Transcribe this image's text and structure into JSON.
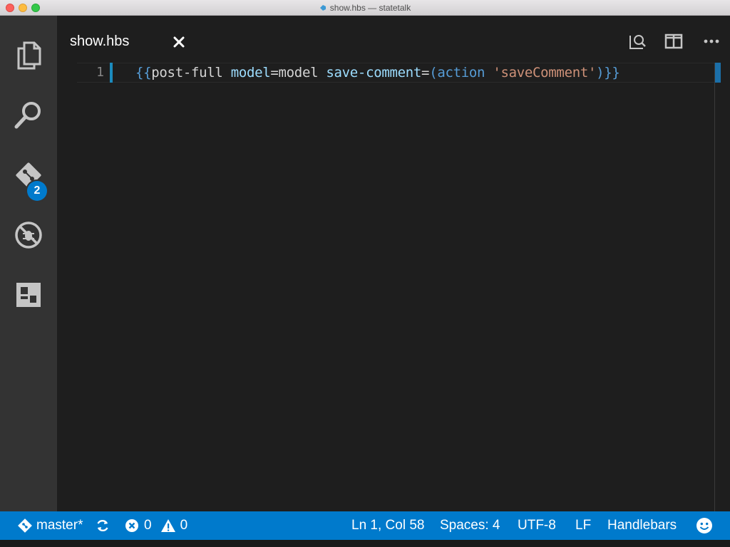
{
  "window": {
    "title": "show.hbs — statetalk"
  },
  "activity_bar": {
    "items": [
      {
        "name": "explorer",
        "icon": "files-icon"
      },
      {
        "name": "search",
        "icon": "search-icon"
      },
      {
        "name": "source-control",
        "icon": "git-icon",
        "badge": "2"
      },
      {
        "name": "debug",
        "icon": "debug-icon"
      },
      {
        "name": "extensions",
        "icon": "extensions-icon"
      }
    ]
  },
  "tab": {
    "label": "show.hbs",
    "close_icon": "close-icon"
  },
  "editor_actions": [
    {
      "name": "open-preview",
      "icon": "preview-search-icon"
    },
    {
      "name": "split-editor",
      "icon": "split-editor-icon"
    },
    {
      "name": "more-actions",
      "icon": "ellipsis-icon"
    }
  ],
  "editor": {
    "line_number": "1",
    "code": "{{post-full model=model save-comment=(action 'saveComment')}}",
    "tokens": {
      "open_braces": "{{",
      "component": "post-full",
      "attr1": "model",
      "eq1": "=",
      "value1": "model",
      "attr2": "save-comment",
      "eq2": "=",
      "open_paren": "(",
      "helper": "action",
      "string": "'saveComment'",
      "close_paren": ")",
      "close_braces": "}}"
    }
  },
  "status_bar": {
    "branch": "master*",
    "errors": "0",
    "warnings": "0",
    "cursor_position": "Ln 1, Col 58",
    "indentation": "Spaces: 4",
    "encoding": "UTF-8",
    "line_ending": "LF",
    "language": "Handlebars"
  },
  "colors": {
    "accent": "#007acc",
    "editor_bg": "#1e1e1e",
    "activity_bg": "#333333"
  }
}
